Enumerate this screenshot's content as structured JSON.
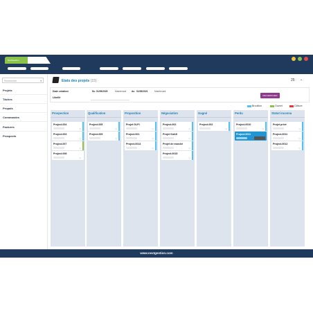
{
  "app": {
    "tab_label": "NextGestion",
    "brand_color": "#8bc34a",
    "frame_color": "#1f3a5c"
  },
  "window_dots": [
    "#f5c542",
    "#8bc34a",
    "#e04a4a"
  ],
  "sidebar": {
    "search_placeholder": "Rechercher",
    "items": [
      "Projets",
      "Tâches",
      "Propals",
      "Commandes",
      "Factures",
      "Prospects"
    ]
  },
  "page": {
    "title": "Etats des projets",
    "count": "(15)",
    "per_page": "25"
  },
  "filters": {
    "date_creation_label": "Date création",
    "from_prefix": "Du",
    "from_date": "01/09/2020",
    "from_suffix": "Maintenant",
    "to_prefix": "Au",
    "to_date": "01/09/2021",
    "to_suffix": "Maintenant",
    "libelle_label": "Libellé",
    "search_button": "RECHERCHER"
  },
  "legend": [
    {
      "label": "Brouillon",
      "color": "#4fc3f7"
    },
    {
      "label": "Ouvert",
      "color": "#8bc34a"
    },
    {
      "label": "Clôture",
      "color": "#e53935"
    }
  ],
  "columns": [
    {
      "title": "Prospection",
      "cards": [
        {
          "name": "Project-004",
          "strip": "#4fc3f7"
        },
        {
          "name": "Project-003",
          "strip": "#4fc3f7"
        },
        {
          "name": "Project-007",
          "strip": "#8bc34a"
        },
        {
          "name": "Project-008",
          "strip": ""
        }
      ]
    },
    {
      "title": "Qualification",
      "cards": [
        {
          "name": "Project-005",
          "strip": "#4fc3f7"
        },
        {
          "name": "Project-009",
          "strip": "#4fc3f7"
        }
      ]
    },
    {
      "title": "Proposition",
      "cards": [
        {
          "name": "Projet GLPI",
          "strip": "#4fc3f7"
        },
        {
          "name": "Project-001",
          "strip": "#4fc3f7"
        },
        {
          "name": "Project-0014",
          "strip": "#4fc3f7"
        }
      ]
    },
    {
      "title": "Négociation",
      "cards": [
        {
          "name": "Project-002",
          "strip": "#4fc3f7"
        },
        {
          "name": "Projet SAAS",
          "strip": "#4fc3f7"
        },
        {
          "name": "Projet de marché",
          "strip": "#4fc3f7"
        },
        {
          "name": "Project-0015",
          "strip": "#4fc3f7"
        }
      ]
    },
    {
      "title": "Gagné",
      "cards": [
        {
          "name": "Project-002",
          "strip": "#4fc3f7"
        }
      ]
    },
    {
      "title": "Perdu",
      "cards": [
        {
          "name": "Project-0010",
          "strip": "#4fc3f7"
        },
        {
          "name": "Project-0011",
          "strip": "",
          "selected": true
        }
      ]
    },
    {
      "title": "Statut inconnu",
      "cards": [
        {
          "name": "Projet privé",
          "strip": "#4fc3f7"
        },
        {
          "name": "Project-0011",
          "strip": "#4fc3f7"
        },
        {
          "name": "Project-0012",
          "strip": "#4fc3f7"
        }
      ]
    }
  ],
  "footer": {
    "text": "www.nextgestion.com"
  }
}
